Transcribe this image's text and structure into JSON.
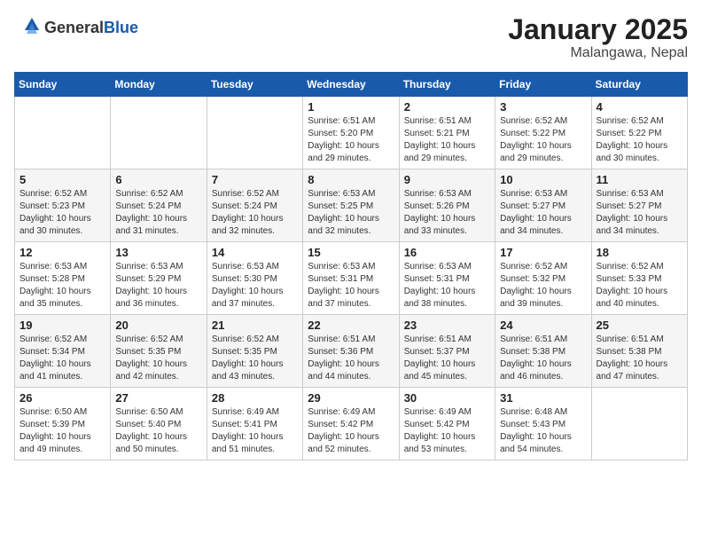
{
  "header": {
    "logo_general": "General",
    "logo_blue": "Blue",
    "month": "January 2025",
    "location": "Malangawa, Nepal"
  },
  "weekdays": [
    "Sunday",
    "Monday",
    "Tuesday",
    "Wednesday",
    "Thursday",
    "Friday",
    "Saturday"
  ],
  "weeks": [
    [
      null,
      null,
      null,
      {
        "day": "1",
        "sunrise": "Sunrise: 6:51 AM",
        "sunset": "Sunset: 5:20 PM",
        "daylight": "Daylight: 10 hours and 29 minutes."
      },
      {
        "day": "2",
        "sunrise": "Sunrise: 6:51 AM",
        "sunset": "Sunset: 5:21 PM",
        "daylight": "Daylight: 10 hours and 29 minutes."
      },
      {
        "day": "3",
        "sunrise": "Sunrise: 6:52 AM",
        "sunset": "Sunset: 5:22 PM",
        "daylight": "Daylight: 10 hours and 29 minutes."
      },
      {
        "day": "4",
        "sunrise": "Sunrise: 6:52 AM",
        "sunset": "Sunset: 5:22 PM",
        "daylight": "Daylight: 10 hours and 30 minutes."
      }
    ],
    [
      {
        "day": "5",
        "sunrise": "Sunrise: 6:52 AM",
        "sunset": "Sunset: 5:23 PM",
        "daylight": "Daylight: 10 hours and 30 minutes."
      },
      {
        "day": "6",
        "sunrise": "Sunrise: 6:52 AM",
        "sunset": "Sunset: 5:24 PM",
        "daylight": "Daylight: 10 hours and 31 minutes."
      },
      {
        "day": "7",
        "sunrise": "Sunrise: 6:52 AM",
        "sunset": "Sunset: 5:24 PM",
        "daylight": "Daylight: 10 hours and 32 minutes."
      },
      {
        "day": "8",
        "sunrise": "Sunrise: 6:53 AM",
        "sunset": "Sunset: 5:25 PM",
        "daylight": "Daylight: 10 hours and 32 minutes."
      },
      {
        "day": "9",
        "sunrise": "Sunrise: 6:53 AM",
        "sunset": "Sunset: 5:26 PM",
        "daylight": "Daylight: 10 hours and 33 minutes."
      },
      {
        "day": "10",
        "sunrise": "Sunrise: 6:53 AM",
        "sunset": "Sunset: 5:27 PM",
        "daylight": "Daylight: 10 hours and 34 minutes."
      },
      {
        "day": "11",
        "sunrise": "Sunrise: 6:53 AM",
        "sunset": "Sunset: 5:27 PM",
        "daylight": "Daylight: 10 hours and 34 minutes."
      }
    ],
    [
      {
        "day": "12",
        "sunrise": "Sunrise: 6:53 AM",
        "sunset": "Sunset: 5:28 PM",
        "daylight": "Daylight: 10 hours and 35 minutes."
      },
      {
        "day": "13",
        "sunrise": "Sunrise: 6:53 AM",
        "sunset": "Sunset: 5:29 PM",
        "daylight": "Daylight: 10 hours and 36 minutes."
      },
      {
        "day": "14",
        "sunrise": "Sunrise: 6:53 AM",
        "sunset": "Sunset: 5:30 PM",
        "daylight": "Daylight: 10 hours and 37 minutes."
      },
      {
        "day": "15",
        "sunrise": "Sunrise: 6:53 AM",
        "sunset": "Sunset: 5:31 PM",
        "daylight": "Daylight: 10 hours and 37 minutes."
      },
      {
        "day": "16",
        "sunrise": "Sunrise: 6:53 AM",
        "sunset": "Sunset: 5:31 PM",
        "daylight": "Daylight: 10 hours and 38 minutes."
      },
      {
        "day": "17",
        "sunrise": "Sunrise: 6:52 AM",
        "sunset": "Sunset: 5:32 PM",
        "daylight": "Daylight: 10 hours and 39 minutes."
      },
      {
        "day": "18",
        "sunrise": "Sunrise: 6:52 AM",
        "sunset": "Sunset: 5:33 PM",
        "daylight": "Daylight: 10 hours and 40 minutes."
      }
    ],
    [
      {
        "day": "19",
        "sunrise": "Sunrise: 6:52 AM",
        "sunset": "Sunset: 5:34 PM",
        "daylight": "Daylight: 10 hours and 41 minutes."
      },
      {
        "day": "20",
        "sunrise": "Sunrise: 6:52 AM",
        "sunset": "Sunset: 5:35 PM",
        "daylight": "Daylight: 10 hours and 42 minutes."
      },
      {
        "day": "21",
        "sunrise": "Sunrise: 6:52 AM",
        "sunset": "Sunset: 5:35 PM",
        "daylight": "Daylight: 10 hours and 43 minutes."
      },
      {
        "day": "22",
        "sunrise": "Sunrise: 6:51 AM",
        "sunset": "Sunset: 5:36 PM",
        "daylight": "Daylight: 10 hours and 44 minutes."
      },
      {
        "day": "23",
        "sunrise": "Sunrise: 6:51 AM",
        "sunset": "Sunset: 5:37 PM",
        "daylight": "Daylight: 10 hours and 45 minutes."
      },
      {
        "day": "24",
        "sunrise": "Sunrise: 6:51 AM",
        "sunset": "Sunset: 5:38 PM",
        "daylight": "Daylight: 10 hours and 46 minutes."
      },
      {
        "day": "25",
        "sunrise": "Sunrise: 6:51 AM",
        "sunset": "Sunset: 5:38 PM",
        "daylight": "Daylight: 10 hours and 47 minutes."
      }
    ],
    [
      {
        "day": "26",
        "sunrise": "Sunrise: 6:50 AM",
        "sunset": "Sunset: 5:39 PM",
        "daylight": "Daylight: 10 hours and 49 minutes."
      },
      {
        "day": "27",
        "sunrise": "Sunrise: 6:50 AM",
        "sunset": "Sunset: 5:40 PM",
        "daylight": "Daylight: 10 hours and 50 minutes."
      },
      {
        "day": "28",
        "sunrise": "Sunrise: 6:49 AM",
        "sunset": "Sunset: 5:41 PM",
        "daylight": "Daylight: 10 hours and 51 minutes."
      },
      {
        "day": "29",
        "sunrise": "Sunrise: 6:49 AM",
        "sunset": "Sunset: 5:42 PM",
        "daylight": "Daylight: 10 hours and 52 minutes."
      },
      {
        "day": "30",
        "sunrise": "Sunrise: 6:49 AM",
        "sunset": "Sunset: 5:42 PM",
        "daylight": "Daylight: 10 hours and 53 minutes."
      },
      {
        "day": "31",
        "sunrise": "Sunrise: 6:48 AM",
        "sunset": "Sunset: 5:43 PM",
        "daylight": "Daylight: 10 hours and 54 minutes."
      },
      null
    ]
  ]
}
